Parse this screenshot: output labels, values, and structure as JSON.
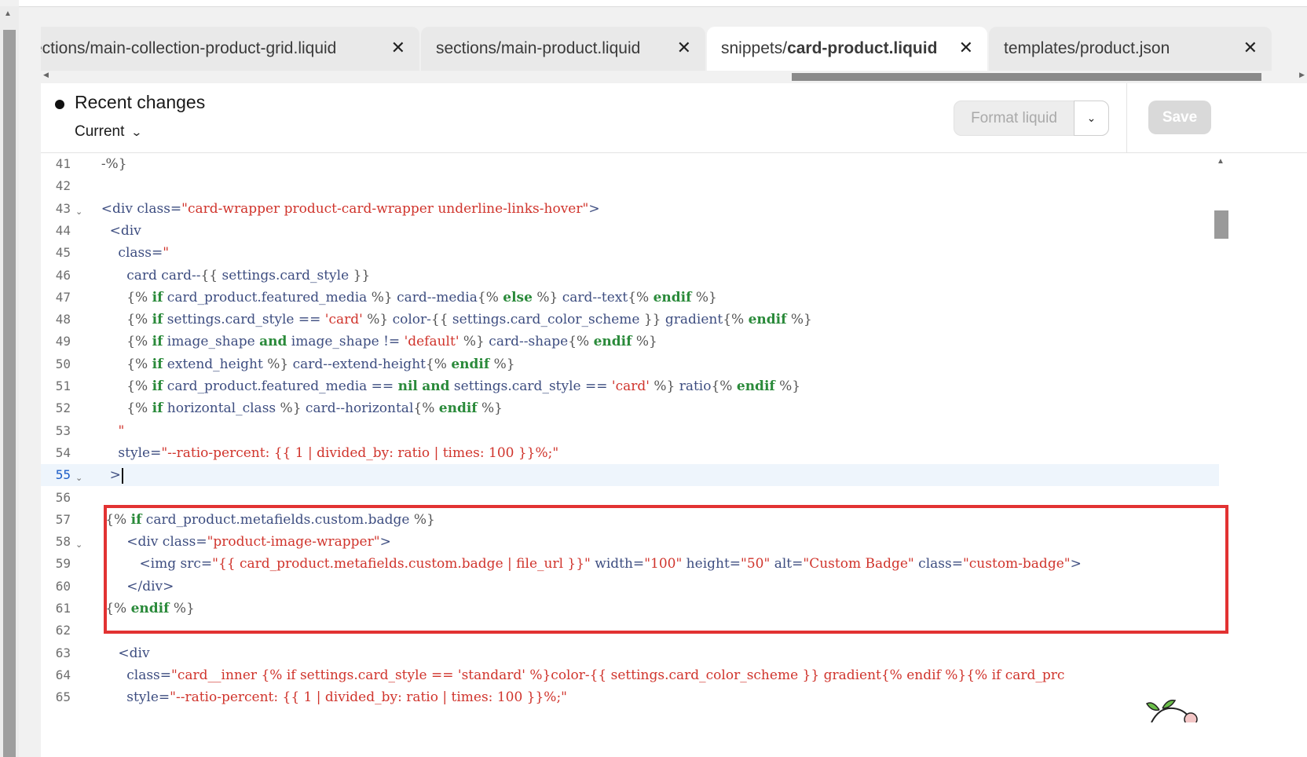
{
  "tabs": [
    {
      "prefix": "sections/",
      "name": "main-collection-product-grid.liquid",
      "shown": "ections/main-collection-product-grid.liquid",
      "active": false
    },
    {
      "prefix": "sections/",
      "name": "main-product.liquid",
      "active": false
    },
    {
      "prefix": "snippets/",
      "name": "card-product.liquid",
      "active": true
    },
    {
      "prefix": "templates/",
      "name": "product.json",
      "active": false
    }
  ],
  "tab_close_glyph": "✕",
  "header": {
    "title": "Recent changes",
    "version": "Current",
    "format_button": "Format liquid",
    "save_button": "Save"
  },
  "colors": {
    "highlight_box": "#e23232",
    "current_line": "#eef5fc"
  },
  "editor": {
    "current_line": 55,
    "lines": [
      {
        "n": "41",
        "fold": false,
        "text": "  -%}"
      },
      {
        "n": "42",
        "fold": false,
        "text": ""
      },
      {
        "n": "43",
        "fold": true,
        "text": "  <div class=\"card-wrapper product-card-wrapper underline-links-hover\">"
      },
      {
        "n": "44",
        "fold": false,
        "text": "    <div"
      },
      {
        "n": "45",
        "fold": false,
        "text": "      class=\""
      },
      {
        "n": "46",
        "fold": false,
        "text": "        card card--{{ settings.card_style }}"
      },
      {
        "n": "47",
        "fold": false,
        "text": "        {% if card_product.featured_media %} card--media{% else %} card--text{% endif %}"
      },
      {
        "n": "48",
        "fold": false,
        "text": "        {% if settings.card_style == 'card' %} color-{{ settings.card_color_scheme }} gradient{% endif %}"
      },
      {
        "n": "49",
        "fold": false,
        "text": "        {% if image_shape and image_shape != 'default' %} card--shape{% endif %}"
      },
      {
        "n": "50",
        "fold": false,
        "text": "        {% if extend_height %} card--extend-height{% endif %}"
      },
      {
        "n": "51",
        "fold": false,
        "text": "        {% if card_product.featured_media == nil and settings.card_style == 'card' %} ratio{% endif %}"
      },
      {
        "n": "52",
        "fold": false,
        "text": "        {% if horizontal_class %} card--horizontal{% endif %}"
      },
      {
        "n": "53",
        "fold": false,
        "text": "      \""
      },
      {
        "n": "54",
        "fold": false,
        "text": "      style=\"--ratio-percent: {{ 1 | divided_by: ratio | times: 100 }}%;\""
      },
      {
        "n": "55",
        "fold": true,
        "text": "    >"
      },
      {
        "n": "56",
        "fold": false,
        "text": ""
      },
      {
        "n": "57",
        "fold": false,
        "text": "   {% if card_product.metafields.custom.badge %}"
      },
      {
        "n": "58",
        "fold": true,
        "text": "        <div class=\"product-image-wrapper\">"
      },
      {
        "n": "59",
        "fold": false,
        "text": "           <img src=\"{{ card_product.metafields.custom.badge | file_url }}\" width=\"100\" height=\"50\" alt=\"Custom Badge\" class=\"custom-badge\">"
      },
      {
        "n": "60",
        "fold": false,
        "text": "        </div>"
      },
      {
        "n": "61",
        "fold": false,
        "text": "   {% endif %}"
      },
      {
        "n": "62",
        "fold": false,
        "text": ""
      },
      {
        "n": "63",
        "fold": false,
        "text": "      <div"
      },
      {
        "n": "64",
        "fold": false,
        "text": "        class=\"card__inner {% if settings.card_style == 'standard' %}color-{{ settings.card_color_scheme }} gradient{% endif %}{% if card_prc"
      },
      {
        "n": "65",
        "fold": false,
        "text": "        style=\"--ratio-percent: {{ 1 | divided_by: ratio | times: 100 }}%;\""
      }
    ]
  }
}
